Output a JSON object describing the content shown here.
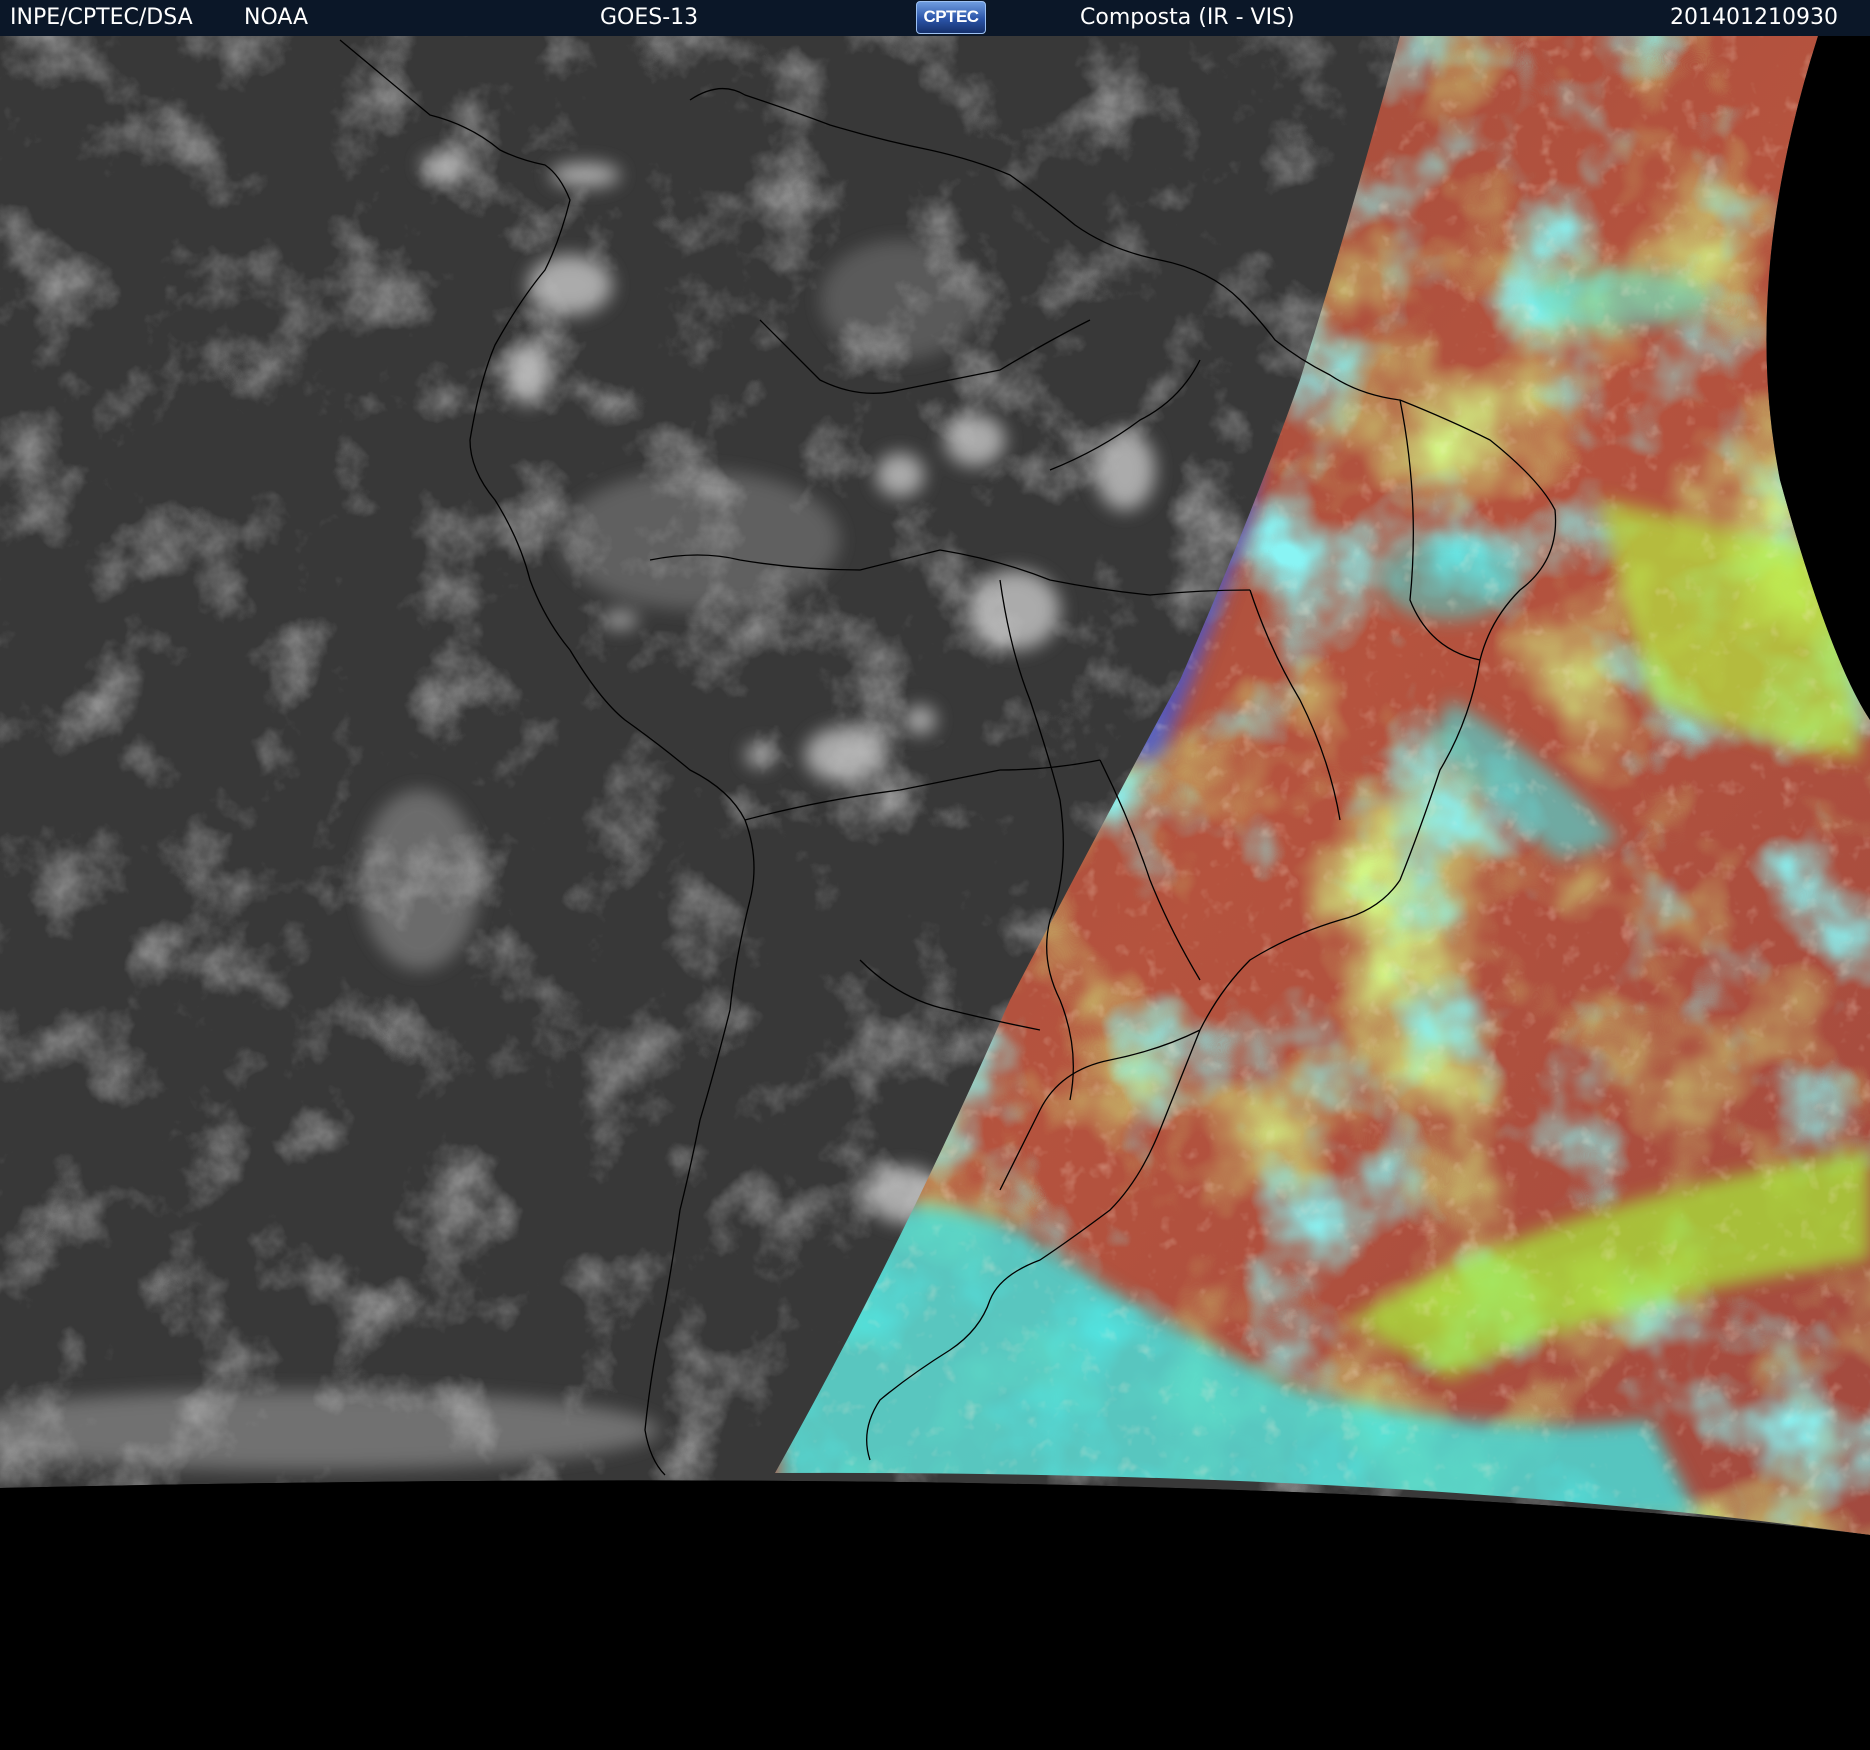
{
  "header": {
    "institution": "INPE/CPTEC/DSA",
    "agency": "NOAA",
    "satellite": "GOES-13",
    "logo_text": "CPTEC",
    "product": "Composta (IR - VIS)",
    "timestamp": "201401210930"
  },
  "colors": {
    "header_background": "#0b1728",
    "ir_region": "#3a3a3a",
    "clouds_ir": "#bdbdbd",
    "vis_red": "#b5533e",
    "vis_green": "#a6e83a",
    "vis_cyan": "#3ee6e4",
    "vis_blue": "#3a55e0",
    "coastline": "#000000",
    "space": "#000000"
  }
}
